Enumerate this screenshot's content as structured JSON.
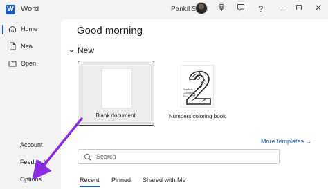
{
  "titlebar": {
    "app_name": "Word",
    "app_logo_letter": "W",
    "user_name": "Pankil Shah"
  },
  "sidebar": {
    "items": [
      {
        "label": "Home",
        "icon": "home-icon",
        "active": true
      },
      {
        "label": "New",
        "icon": "new-document-icon",
        "active": false
      },
      {
        "label": "Open",
        "icon": "folder-icon",
        "active": false
      }
    ],
    "bottom": {
      "account": "Account",
      "feedback": "Feedback",
      "options": "Options"
    }
  },
  "main": {
    "greeting": "Good morning",
    "new_section": "New",
    "templates": [
      {
        "label": "Blank document",
        "selected": true
      },
      {
        "label": "Numbers coloring book",
        "cover_text": "Numbers Coloring Book",
        "selected": false
      }
    ],
    "more_templates": "More templates →",
    "search": {
      "placeholder": "Search",
      "value": ""
    },
    "tabs": [
      {
        "label": "Recent",
        "active": true
      },
      {
        "label": "Pinned",
        "active": false
      },
      {
        "label": "Shared with Me",
        "active": false
      }
    ]
  },
  "annotation": {
    "arrow_color": "#8a2be2",
    "points_to": "Options"
  },
  "colors": {
    "accent": "#185abd",
    "link": "#1e5bb5",
    "sidebar_bg": "#f3f3f3",
    "main_bg": "#ffffff"
  }
}
